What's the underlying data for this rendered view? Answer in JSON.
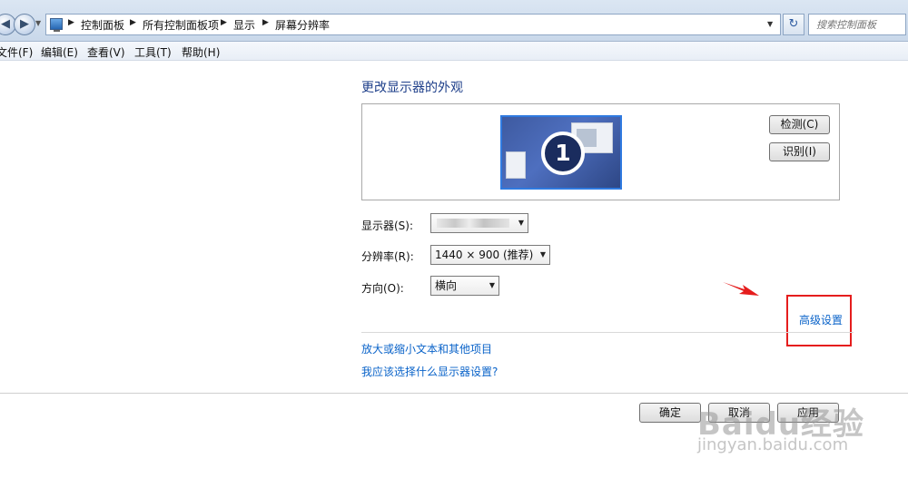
{
  "address_bar": {
    "breadcrumbs": [
      "控制面板",
      "所有控制面板项",
      "显示",
      "屏幕分辨率"
    ],
    "search_placeholder": "搜索控制面板"
  },
  "menu": {
    "items": [
      "文件(F)",
      "编辑(E)",
      "查看(V)",
      "工具(T)",
      "帮助(H)"
    ]
  },
  "main": {
    "title": "更改显示器的外观",
    "monitor_number": "1",
    "detect_label": "检测(C)",
    "identify_label": "识别(I)",
    "display_label": "显示器(S):",
    "display_value": "",
    "resolution_label": "分辨率(R):",
    "resolution_value": "1440 × 900 (推荐)",
    "orientation_label": "方向(O):",
    "orientation_value": "横向",
    "advanced_link": "高级设置",
    "link_enlarge": "放大或缩小文本和其他项目",
    "link_which": "我应该选择什么显示器设置?"
  },
  "buttons": {
    "ok": "确定",
    "cancel": "取消",
    "apply": "应用"
  },
  "watermark": {
    "main": "Baidu经验",
    "sub": "jingyan.baidu.com"
  },
  "colors": {
    "link": "#0a63c9",
    "title": "#1e3f8a",
    "annotation": "#e51d1d"
  },
  "icons": [
    "back-arrow-icon",
    "forward-arrow-icon",
    "control-panel-icon",
    "refresh-icon",
    "monitor-icon"
  ]
}
